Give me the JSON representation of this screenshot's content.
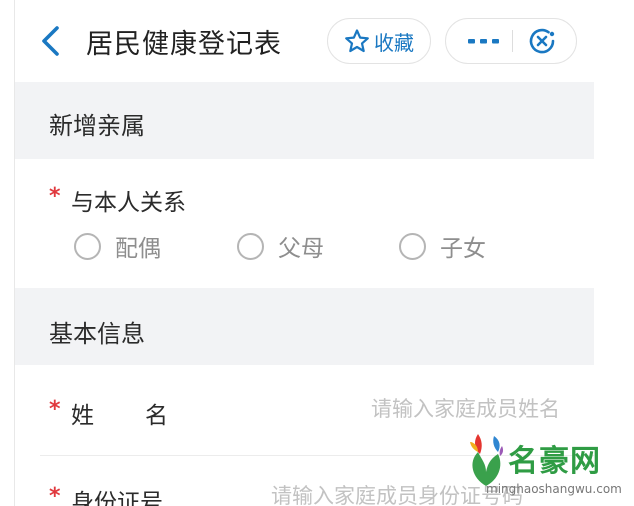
{
  "header": {
    "title": "居民健康登记表",
    "favorite_label": "收藏"
  },
  "sections": {
    "add_relative": "新增亲属",
    "basic_info": "基本信息"
  },
  "relation_field": {
    "required_mark": "*",
    "label": "与本人关系",
    "options": [
      "配偶",
      "父母",
      "子女"
    ]
  },
  "name_field": {
    "required_mark": "*",
    "label_char1": "姓",
    "label_char2": "名",
    "value": "",
    "placeholder": "请输入家庭成员姓名"
  },
  "id_field": {
    "required_mark": "*",
    "label": "身份证号",
    "value": "",
    "placeholder": "请输入家庭成员身份证号码"
  },
  "watermark": {
    "text": "名豪网",
    "url": "minghaoshangwu.com"
  },
  "colors": {
    "accent": "#1a78c2",
    "required": "#e0393e",
    "section_bg": "#f2f3f5",
    "placeholder": "#c2c2c2"
  },
  "icons": {
    "back": "chevron-left-icon",
    "favorite": "star-outline-icon",
    "more": "more-dots-icon",
    "close": "close-circle-icon"
  }
}
